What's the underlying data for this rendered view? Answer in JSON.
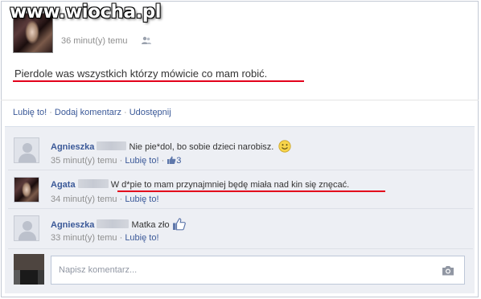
{
  "watermark": "www.wiocha.pl",
  "post": {
    "time": "36 minut(y) temu",
    "privacy_icon": "friends-icon",
    "text": "Pierdole was wszystkich którzy mówicie co mam robić."
  },
  "actions": {
    "like": "Lubię to!",
    "comment": "Dodaj komentarz",
    "share": "Udostępnij"
  },
  "comments": [
    {
      "author": "Agnieszka",
      "text": "Nie pie*dol, bo sobie dzieci narobisz.",
      "emoticon": "smiley-icon",
      "time": "35 minut(y) temu",
      "like_label": "Lubię to!",
      "like_count": "3"
    },
    {
      "author": "Agata",
      "text": "W d*pie to mam przynajmniej będę miała nad kin się znęcać.",
      "time": "34 minut(y) temu",
      "like_label": "Lubię to!"
    },
    {
      "author": "Agnieszka",
      "text": "Matka zło",
      "emoticon": "thumbs-up-icon",
      "time": "33 minut(y) temu",
      "like_label": "Lubię to!"
    }
  ],
  "comment_input": {
    "placeholder": "Napisz komentarz..."
  },
  "colors": {
    "link": "#3b5998",
    "meta": "#8f8f8f",
    "panel": "#edeff4",
    "highlight": "#e3001b"
  }
}
